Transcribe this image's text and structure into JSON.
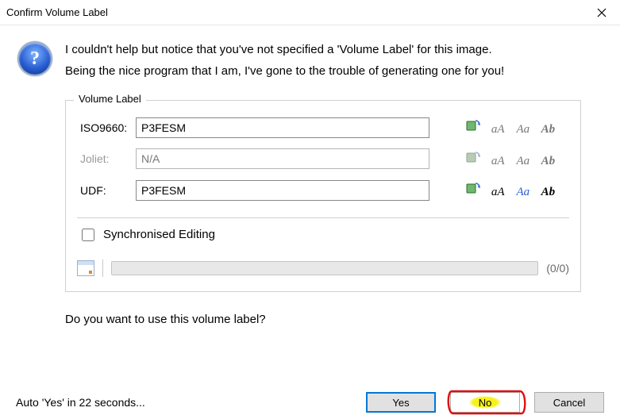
{
  "window": {
    "title": "Confirm Volume Label"
  },
  "message": {
    "line1": "I couldn't help but notice that you've not specified a 'Volume Label' for this image.",
    "line2": "Being the nice program that I am, I've gone to the trouble of generating one for you!"
  },
  "group": {
    "legend": "Volume Label",
    "rows": {
      "iso9660": {
        "label": "ISO9660:",
        "value": "P3FESM",
        "enabled": true
      },
      "joliet": {
        "label": "Joliet:",
        "value": "N/A",
        "enabled": false
      },
      "udf": {
        "label": "UDF:",
        "value": "P3FESM",
        "enabled": true
      }
    },
    "sync_label": "Synchronised Editing",
    "sync_checked": false,
    "progress_text": "(0/0)"
  },
  "confirm_question": "Do you want to use this volume label?",
  "footer": {
    "auto_text": "Auto 'Yes' in 22 seconds...",
    "yes": "Yes",
    "no": "No",
    "cancel": "Cancel"
  },
  "icon_glyphs": {
    "aa_upper": "aA",
    "aa_cap": "Aa",
    "ab": "Ab"
  }
}
